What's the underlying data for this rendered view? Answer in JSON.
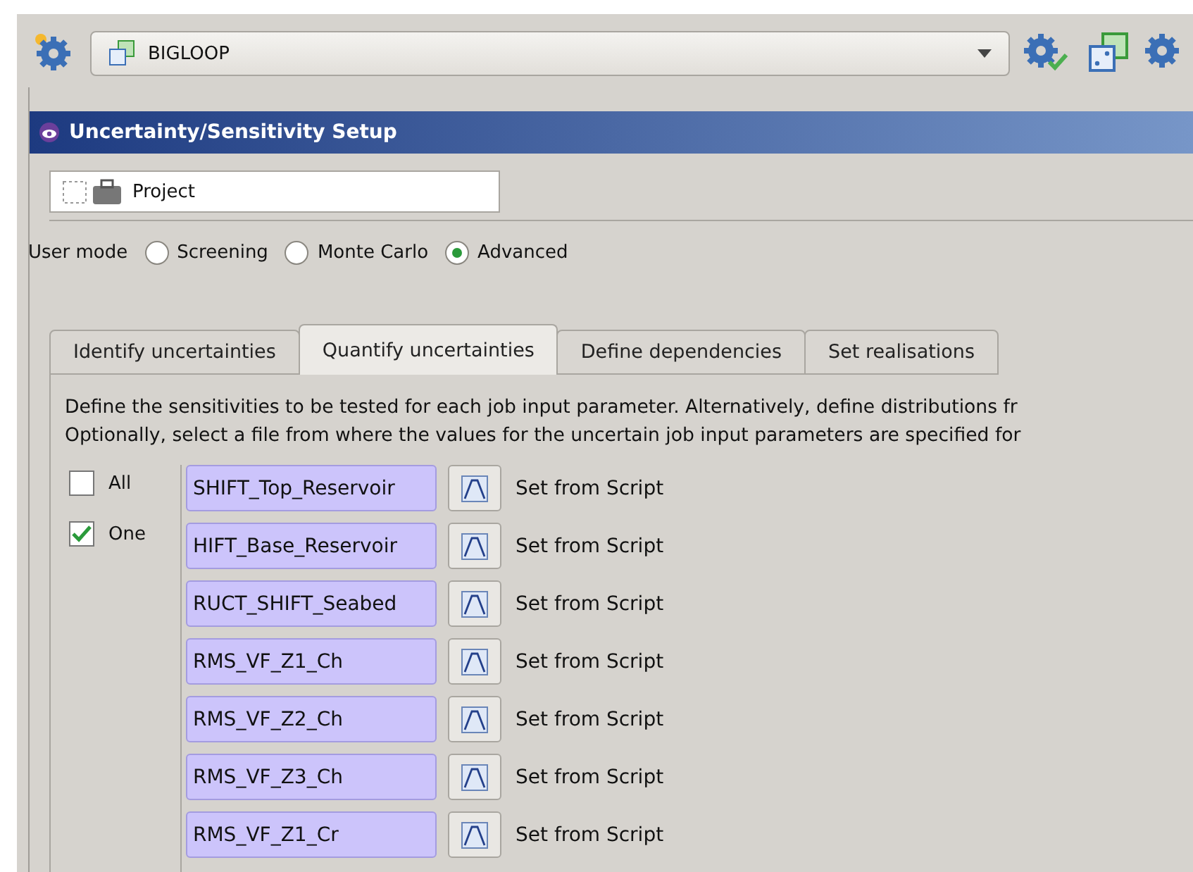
{
  "toolbar": {
    "scenario": "BIGLOOP"
  },
  "panel": {
    "title": "Uncertainty/Sensitivity Setup",
    "project": "Project"
  },
  "user_mode": {
    "label": "User mode",
    "options": [
      {
        "label": "Screening",
        "selected": false
      },
      {
        "label": "Monte Carlo",
        "selected": false
      },
      {
        "label": "Advanced",
        "selected": true
      }
    ]
  },
  "tabs": [
    {
      "label": "Identify uncertainties",
      "selected": false
    },
    {
      "label": "Quantify uncertainties",
      "selected": true
    },
    {
      "label": "Define dependencies",
      "selected": false
    },
    {
      "label": "Set realisations",
      "selected": false
    }
  ],
  "description": [
    "Define the sensitivities to be tested for each job input parameter. Alternatively, define distributions fr",
    "Optionally, select a file from where the values for the uncertain job input parameters are specified for"
  ],
  "filters": [
    {
      "label": "All",
      "checked": false
    },
    {
      "label": "One",
      "checked": true
    }
  ],
  "parameters": [
    {
      "name": "SHIFT_Top_Reservoir",
      "setting": "Set from Script"
    },
    {
      "name": "HIFT_Base_Reservoir",
      "setting": "Set from Script"
    },
    {
      "name": "RUCT_SHIFT_Seabed",
      "setting": "Set from Script"
    },
    {
      "name": "RMS_VF_Z1_Ch",
      "setting": "Set from Script"
    },
    {
      "name": "RMS_VF_Z2_Ch",
      "setting": "Set from Script"
    },
    {
      "name": "RMS_VF_Z3_Ch",
      "setting": "Set from Script"
    },
    {
      "name": "RMS_VF_Z1_Cr",
      "setting": "Set from Script"
    }
  ]
}
